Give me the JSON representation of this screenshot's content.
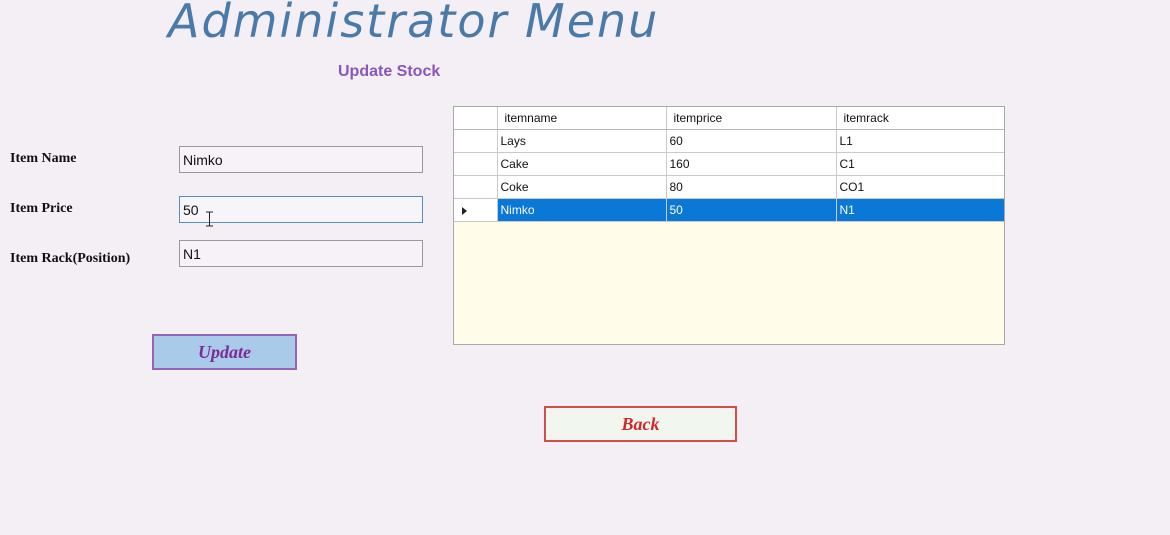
{
  "window": {
    "title": "Administrator Menu",
    "subtitle": "Update Stock"
  },
  "form": {
    "item_name": {
      "label": "Item Name",
      "value": "Nimko"
    },
    "item_price": {
      "label": "Item Price",
      "value": "50"
    },
    "item_rack": {
      "label": "Item Rack(Position)",
      "value": "N1"
    }
  },
  "buttons": {
    "update_label": "Update",
    "back_label": "Back"
  },
  "grid": {
    "columns": [
      "itemname",
      "itemprice",
      "itemrack"
    ],
    "rows": [
      [
        "Lays",
        "60",
        "L1"
      ],
      [
        "Cake",
        "160",
        "C1"
      ],
      [
        "Coke",
        "80",
        "CO1"
      ],
      [
        "Nimko",
        "50",
        "N1"
      ]
    ],
    "selected_row_index": 3
  },
  "colors": {
    "title": "#4a7aa8",
    "subtitle": "#8a57b8",
    "selection": "#0a78d7",
    "grid_background": "#fffde9",
    "update_button_fill": "#a9cbe9",
    "back_button_text": "#d12a2a"
  },
  "icons": {
    "row_indicator": "current-row-arrow-icon",
    "cursor": "text-ibeam-cursor-icon"
  }
}
